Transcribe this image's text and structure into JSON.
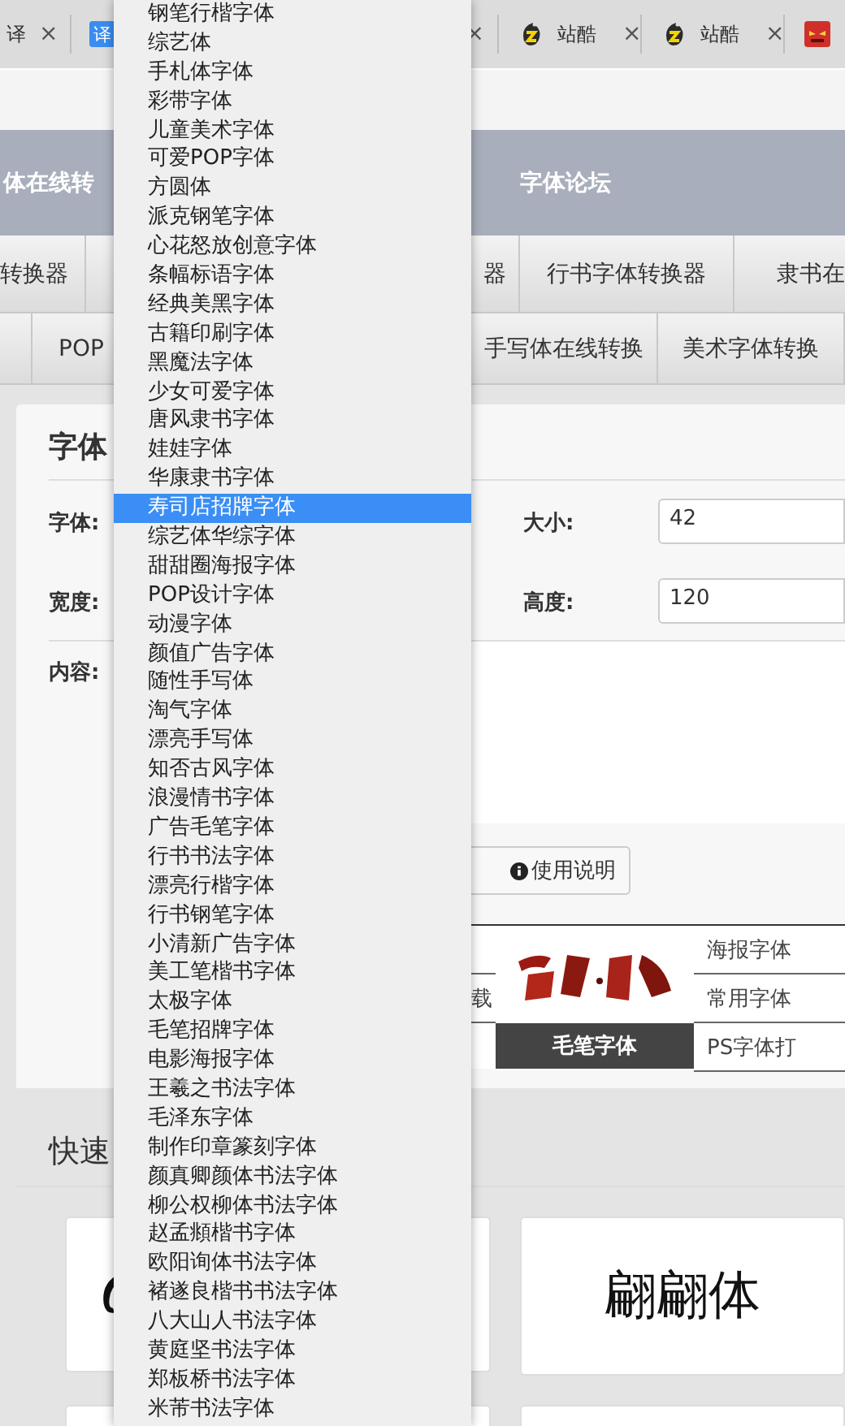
{
  "browser_tabs": [
    {
      "kind": "text",
      "title": "译",
      "close": "×"
    },
    {
      "kind": "translate",
      "icon_text": "译",
      "close": "×"
    },
    {
      "kind": "site",
      "title": "站酷",
      "close": "×"
    },
    {
      "kind": "site",
      "title": "站酷",
      "close": "×"
    },
    {
      "kind": "game"
    }
  ],
  "nav_links": [
    "体在线转",
    "字体论坛"
  ],
  "converter_tabs": [
    [
      "转换器",
      "器",
      "行书字体转换器",
      "隶书在"
    ],
    [
      "POP",
      "手写体在线转换",
      "美术字体转换"
    ]
  ],
  "form": {
    "title": "字体",
    "font_label": "字体:",
    "width_label": "宽度:",
    "content_label": "内容:",
    "size_label": "大小:",
    "size_value": "42",
    "height_label": "高度:",
    "height_value": "120",
    "help_button": "使用说明"
  },
  "downloads": {
    "left_item": "载",
    "featured_label": "毛笔字体",
    "links": [
      "海报字体",
      "常用字体",
      "PS字体打"
    ]
  },
  "quick": {
    "heading": "快速",
    "cards": [
      {
        "kind": "picture"
      },
      {
        "kind": "sample",
        "text": "翩翩体"
      }
    ]
  },
  "font_dropdown": {
    "items": [
      {
        "label": "钢笔行楷字体",
        "selected": false
      },
      {
        "label": "综艺体",
        "selected": false
      },
      {
        "label": "手札体字体",
        "selected": false
      },
      {
        "label": "彩带字体",
        "selected": false
      },
      {
        "label": "儿童美术字体",
        "selected": false
      },
      {
        "label": "可爱POP字体",
        "selected": false
      },
      {
        "label": "方圆体",
        "selected": false
      },
      {
        "label": "派克钢笔字体",
        "selected": false
      },
      {
        "label": "心花怒放创意字体",
        "selected": false
      },
      {
        "label": "条幅标语字体",
        "selected": false
      },
      {
        "label": "经典美黑字体",
        "selected": false
      },
      {
        "label": "古籍印刷字体",
        "selected": false
      },
      {
        "label": "黑魔法字体",
        "selected": false
      },
      {
        "label": "少女可爱字体",
        "selected": false
      },
      {
        "label": "唐风隶书字体",
        "selected": false
      },
      {
        "label": "娃娃字体",
        "selected": false
      },
      {
        "label": "华康隶书字体",
        "selected": false
      },
      {
        "label": "寿司店招牌字体",
        "selected": true
      },
      {
        "label": "综艺体华综字体",
        "selected": false
      },
      {
        "label": "甜甜圈海报字体",
        "selected": false
      },
      {
        "label": "POP设计字体",
        "selected": false
      },
      {
        "label": "动漫字体",
        "selected": false
      },
      {
        "label": "颜值广告字体",
        "selected": false
      },
      {
        "label": "随性手写体",
        "selected": false
      },
      {
        "label": "淘气字体",
        "selected": false
      },
      {
        "label": "漂亮手写体",
        "selected": false
      },
      {
        "label": "知否古风字体",
        "selected": false
      },
      {
        "label": "浪漫情书字体",
        "selected": false
      },
      {
        "label": "广告毛笔字体",
        "selected": false
      },
      {
        "label": "行书书法字体",
        "selected": false
      },
      {
        "label": "漂亮行楷字体",
        "selected": false
      },
      {
        "label": "行书钢笔字体",
        "selected": false
      },
      {
        "label": "小清新广告字体",
        "selected": false
      },
      {
        "label": "美工笔楷书字体",
        "selected": false
      },
      {
        "label": "太极字体",
        "selected": false
      },
      {
        "label": "毛笔招牌字体",
        "selected": false
      },
      {
        "label": "电影海报字体",
        "selected": false
      },
      {
        "label": "王羲之书法字体",
        "selected": false
      },
      {
        "label": "毛泽东字体",
        "selected": false
      },
      {
        "label": "制作印章篆刻字体",
        "selected": false
      },
      {
        "label": "颜真卿颜体书法字体",
        "selected": false
      },
      {
        "label": "柳公权柳体书法字体",
        "selected": false
      },
      {
        "label": "赵孟頫楷书字体",
        "selected": false
      },
      {
        "label": "欧阳询体书法字体",
        "selected": false
      },
      {
        "label": "褚遂良楷书书法字体",
        "selected": false
      },
      {
        "label": "八大山人书法字体",
        "selected": false
      },
      {
        "label": "黄庭坚书法字体",
        "selected": false
      },
      {
        "label": "郑板桥书法字体",
        "selected": false
      },
      {
        "label": "米芾书法字体",
        "selected": false
      }
    ]
  }
}
